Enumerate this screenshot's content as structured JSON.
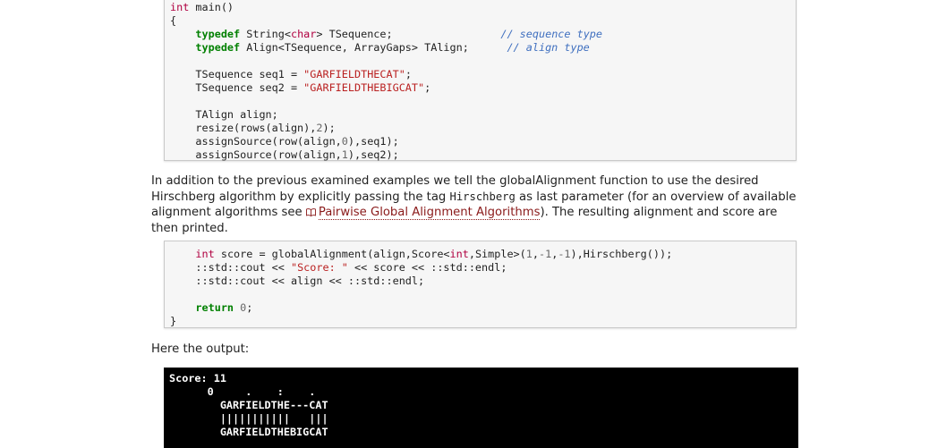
{
  "code1": {
    "l1_type": "int",
    "l1_rest": " main()",
    "l2": "{",
    "l3_kw": "typedef",
    "l3_a": " String<",
    "l3_ty": "char",
    "l3_b": "> TSequence;",
    "l3_pad": "                 ",
    "l3_comment": "// sequence type",
    "l4_kw": "typedef",
    "l4_a": " Align<TSequence, ArrayGaps> TAlign;",
    "l4_pad": "      ",
    "l4_comment": "// align type",
    "l6_a": "TSequence seq1 = ",
    "l6_str": "\"GARFIELDTHECAT\"",
    "l6_b": ";",
    "l7_a": "TSequence seq2 = ",
    "l7_str": "\"GARFIELDTHEBIGCAT\"",
    "l7_b": ";",
    "l9": "TAlign align;",
    "l10_a": "resize(rows(align),",
    "l10_num": "2",
    "l10_b": ");",
    "l11_a": "assignSource(row(align,",
    "l11_num": "0",
    "l11_b": "),seq1);",
    "l12_a": "assignSource(row(align,",
    "l12_num": "1",
    "l12_b": "),seq2);"
  },
  "paragraph1": {
    "text_a": "In addition to the previous examined examples we tell the globalAlignment function to use the desired Hirschberg algorithm by explicitly passing the tag ",
    "tag": "Hirschberg",
    "text_b": " as last parameter (for an overview of available alignment algorithms see ",
    "link_icon": "book-icon",
    "link": "Pairwise Global Alignment Algorithms",
    "text_c": "). The resulting alignment and score are then printed."
  },
  "code2": {
    "l1_type": "int",
    "l1_a": " score = globalAlignment(align,Score<",
    "l1_ty1": "int",
    "l1_b": ",Simple>(",
    "l1_n1": "1",
    "l1_c": ",",
    "l1_n2": "-1",
    "l1_d": ",",
    "l1_n3": "-1",
    "l1_e": "),Hirschberg());",
    "l2_a": "::std::cout << ",
    "l2_str": "\"Score: \"",
    "l2_b": " << score << ::std::endl;",
    "l3": "::std::cout << align << ::std::endl;",
    "l5_kw": "return",
    "l5_num": "0",
    "l5_b": ";",
    "l6": "}"
  },
  "paragraph2": {
    "text": "Here the output:"
  },
  "output": {
    "l1": "Score: 11",
    "l2": "      0     .    :    .",
    "l3": "        GARFIELDTHE---CAT",
    "l4": "        |||||||||||   |||",
    "l5": "        GARFIELDTHEBIGCAT"
  }
}
